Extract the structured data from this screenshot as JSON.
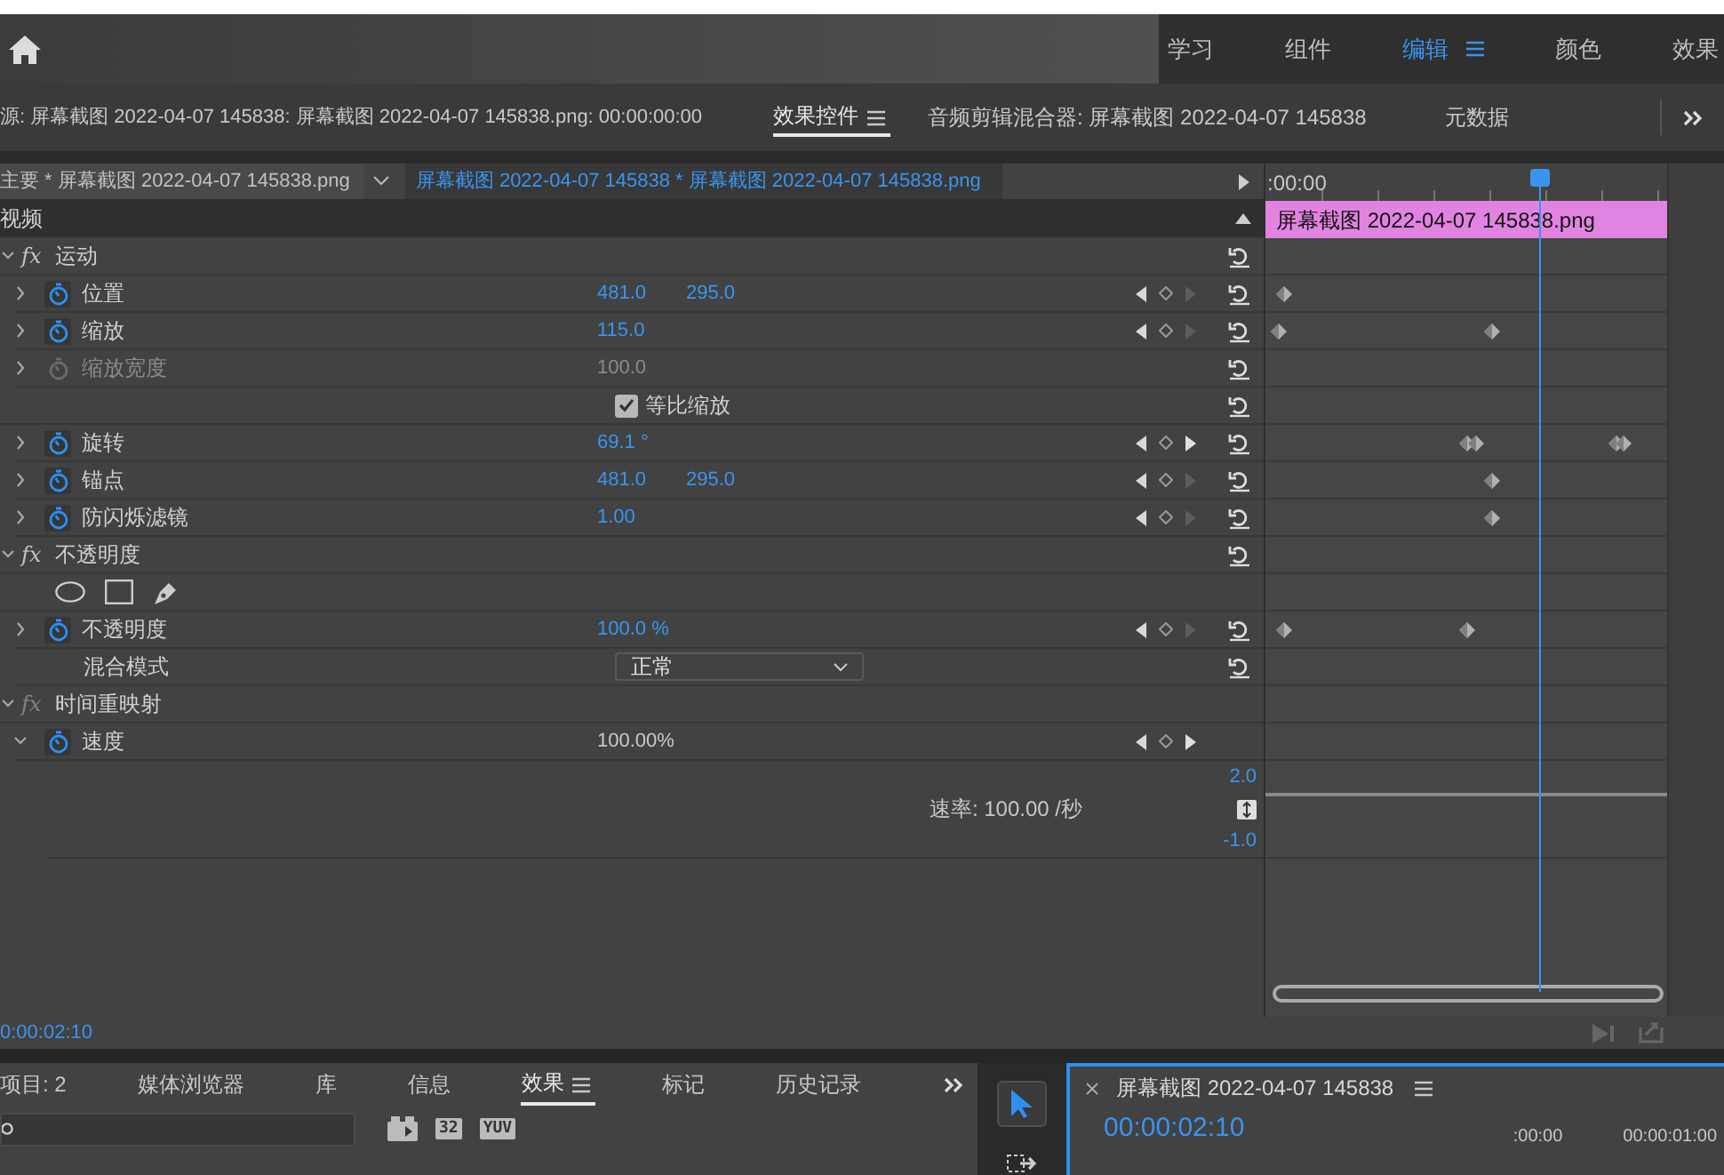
{
  "header": {
    "workspaces": [
      {
        "label": "学习",
        "selected": false
      },
      {
        "label": "组件",
        "selected": false
      },
      {
        "label": "编辑",
        "selected": true
      },
      {
        "label": "颜色",
        "selected": false
      },
      {
        "label": "效果",
        "selected": false
      }
    ]
  },
  "panel_tabs": {
    "source": "源: 屏幕截图 2022-04-07  145838: 屏幕截图 2022-04-07  145838.png: 00:00:00:00",
    "tabs": [
      {
        "label": "效果控件",
        "selected": true
      },
      {
        "label": "音频剪辑混合器: 屏幕截图 2022-04-07 145838",
        "selected": false
      },
      {
        "label": "元数据",
        "selected": false
      }
    ]
  },
  "clip_header": {
    "master": "主要 * 屏幕截图 2022-04-07  145838.png",
    "sequence": "屏幕截图 2022-04-07  145838 * 屏幕截图 2022-04-07  145838.png"
  },
  "timeline": {
    "ruler_start": ":00:00",
    "clip": "屏幕截图 2022-04-07  145838.png"
  },
  "section": "视频",
  "rows": [
    {
      "kind": "effect",
      "badge": "fx",
      "label": "运动",
      "expanded": true,
      "enabled": true,
      "reset": true
    },
    {
      "kind": "property",
      "label": "位置",
      "values": [
        "481.0",
        "295.0"
      ],
      "animated": true,
      "disabled": false,
      "editable": true,
      "expanded": false,
      "next_enabled": false,
      "reset": true
    },
    {
      "kind": "property",
      "label": "缩放",
      "values": [
        "115.0"
      ],
      "animated": true,
      "disabled": false,
      "editable": true,
      "expanded": false,
      "next_enabled": false,
      "reset": true
    },
    {
      "kind": "property",
      "label": "缩放宽度",
      "values": [
        "100.0"
      ],
      "animated": false,
      "disabled": true,
      "editable": true,
      "expanded": false,
      "reset": true
    },
    {
      "kind": "checkbox",
      "label": "等比缩放",
      "checked": true,
      "reset": true
    },
    {
      "kind": "property",
      "label": "旋转",
      "values": [
        "69.1 °"
      ],
      "animated": true,
      "disabled": false,
      "editable": true,
      "expanded": false,
      "next_enabled": true,
      "reset": true
    },
    {
      "kind": "property",
      "label": "锚点",
      "values": [
        "481.0",
        "295.0"
      ],
      "animated": true,
      "disabled": false,
      "editable": true,
      "expanded": false,
      "next_enabled": false,
      "reset": true
    },
    {
      "kind": "property",
      "label": "防闪烁滤镜",
      "values": [
        "1.00"
      ],
      "animated": true,
      "disabled": false,
      "editable": true,
      "expanded": false,
      "next_enabled": false,
      "reset": true
    },
    {
      "kind": "effect",
      "badge": "fx",
      "label": "不透明度",
      "expanded": true,
      "enabled": true,
      "reset": true
    },
    {
      "kind": "masks"
    },
    {
      "kind": "property",
      "label": "不透明度",
      "values": [
        "100.0 %"
      ],
      "animated": true,
      "disabled": false,
      "editable": true,
      "expanded": false,
      "next_enabled": false,
      "reset": true
    },
    {
      "kind": "dropdown",
      "label": "混合模式",
      "value": "正常",
      "reset": true
    },
    {
      "kind": "effect",
      "badge": "fx",
      "label": "时间重映射",
      "expanded": true,
      "enabled": false,
      "reset": false
    },
    {
      "kind": "property",
      "label": "速度",
      "values": [
        "100.00%"
      ],
      "animated": true,
      "disabled": false,
      "editable": false,
      "expanded": true,
      "next_enabled": true,
      "reset": false
    },
    {
      "kind": "graph",
      "rate": "速率: 100.00 /秒",
      "max": "2.0",
      "min": "-1.0"
    }
  ],
  "timecode": "0:00:02:10",
  "bottom_panel": {
    "tabs": [
      {
        "label": "项目: 2",
        "selected": false
      },
      {
        "label": "媒体浏览器",
        "selected": false
      },
      {
        "label": "库",
        "selected": false
      },
      {
        "label": "信息",
        "selected": false
      },
      {
        "label": "效果",
        "selected": true
      },
      {
        "label": "标记",
        "selected": false
      },
      {
        "label": "历史记录",
        "selected": false
      }
    ],
    "filter_buttons": [
      "32",
      "YUV"
    ]
  },
  "tools": [
    {
      "kind": "selection",
      "selected": true
    },
    {
      "kind": "track_select",
      "selected": false
    }
  ],
  "monitor": {
    "title": "屏幕截图 2022-04-07 145838",
    "timecode": "00:00:02:10",
    "ruler": [
      ":00:00",
      "00:00:01:00"
    ]
  }
}
